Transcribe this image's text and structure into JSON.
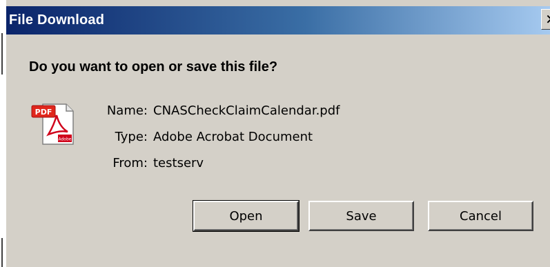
{
  "window": {
    "title": "File Download",
    "close_glyph": "✕"
  },
  "dialog": {
    "question": "Do you want to open or save this file?",
    "icon": "pdf-file-icon",
    "icon_badge": "PDF",
    "icon_logo_text": "Adobe",
    "fields": [
      {
        "label": "Name:",
        "value": "CNASCheckClaimCalendar.pdf"
      },
      {
        "label": "Type:",
        "value": "Adobe Acrobat Document"
      },
      {
        "label": "From:",
        "value": "testserv"
      }
    ],
    "buttons": {
      "open": "Open",
      "save": "Save",
      "cancel": "Cancel"
    }
  },
  "colors": {
    "titlebar_start": "#0a246a",
    "titlebar_end": "#a6caf0",
    "dialog_bg": "#d4d0c8",
    "pdf_badge": "#e0261c"
  }
}
